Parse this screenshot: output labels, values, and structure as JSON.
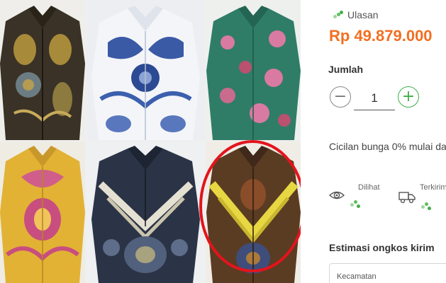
{
  "product_grid": {
    "items": [
      {
        "name": "Batik shirt dark brown gold"
      },
      {
        "name": "Batik shirt white blue"
      },
      {
        "name": "Batik shirt green pink"
      },
      {
        "name": "Batik shirt yellow pink"
      },
      {
        "name": "Batik shirt grey navy"
      },
      {
        "name": "Batik shirt brown yellow"
      }
    ]
  },
  "product": {
    "reviews_label": "Ulasan",
    "price": "Rp 49.879.000"
  },
  "quantity": {
    "label": "Jumlah",
    "value": "1",
    "minus_symbol": "−",
    "plus_symbol": "+"
  },
  "installment_text": "Cicilan bunga 0% mulai da",
  "stats": {
    "seen_label": "Dilihat",
    "sent_label": "Terkirim"
  },
  "shipping": {
    "title": "Estimasi ongkos kirim",
    "district_placeholder": "Kecamatan"
  },
  "colors": {
    "price": "#f26f21",
    "accent_green": "#3fae49",
    "highlight_ring": "#e3141c"
  }
}
